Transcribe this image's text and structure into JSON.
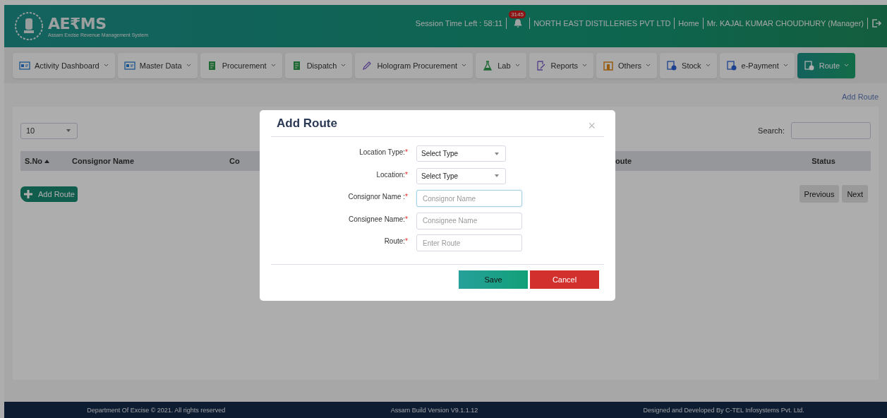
{
  "header": {
    "logo": {
      "text": "AE₹MS",
      "subtitle": "Assam Excise Revenue Management System"
    },
    "session": "Session Time Left : 58:11",
    "notifications": "3145",
    "company": "NORTH EAST DISTILLERIES PVT LTD",
    "home": "Home",
    "user": "Mr. KAJAL KUMAR CHOUDHURY (Manager)"
  },
  "nav": [
    {
      "label": "Activity Dashboard",
      "selected": false
    },
    {
      "label": "Master Data",
      "selected": false
    },
    {
      "label": "Procurement",
      "selected": false
    },
    {
      "label": "Dispatch",
      "selected": false
    },
    {
      "label": "Hologram Procurement",
      "selected": false
    },
    {
      "label": "Lab",
      "selected": false
    },
    {
      "label": "Reports",
      "selected": false
    },
    {
      "label": "Others",
      "selected": false
    },
    {
      "label": "Stock",
      "selected": false
    },
    {
      "label": "e-Payment",
      "selected": false
    },
    {
      "label": "Route",
      "selected": true
    }
  ],
  "breadcrumb": "Add Route",
  "table": {
    "page_size": "10",
    "search_label": "Search:",
    "columns": [
      {
        "label": "S.No",
        "sorted": true
      },
      {
        "label": "Consignor Name",
        "sorted": false
      },
      {
        "label": "Co",
        "sorted": false
      },
      {
        "label": "oute",
        "sorted": false
      },
      {
        "label": "Status",
        "sorted": false
      }
    ],
    "add_button": "Add Route",
    "pagination": [
      "Previous",
      "Next"
    ]
  },
  "modal": {
    "title": "Add Route",
    "close": "×",
    "fields": [
      {
        "kind": "select",
        "label": "Location Type:",
        "mark": "*",
        "value": "Select Type",
        "focused": false
      },
      {
        "kind": "select",
        "label": "Location:",
        "mark": "*",
        "value": "Select Type",
        "focused": false
      },
      {
        "kind": "input",
        "label": "Consignor Name :",
        "mark": "*",
        "placeholder": "Consignor Name",
        "focused": true
      },
      {
        "kind": "input",
        "label": "Consignee Name:",
        "mark": "*",
        "placeholder": "Consignee Name",
        "focused": false
      },
      {
        "kind": "input",
        "label": "Route:",
        "mark": "*",
        "placeholder": "Enter Route",
        "focused": false
      }
    ],
    "buttons": [
      {
        "kind": "save",
        "label": "Save"
      },
      {
        "kind": "cancel",
        "label": "Cancel"
      }
    ]
  },
  "footer": [
    "Department Of Excise © 2021. All rights reserved",
    "Assam Build Version V9.1.1.12",
    "Designed and Developed By C-TEL Infosystems Pvt. Ltd."
  ]
}
